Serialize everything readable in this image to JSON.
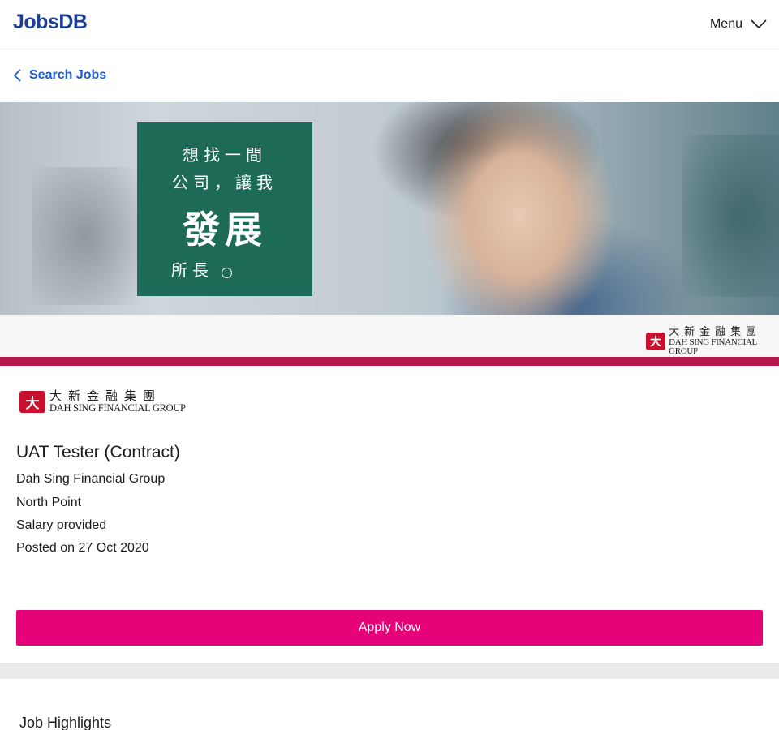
{
  "header": {
    "logo_text": "JobsDB",
    "menu_label": "Menu"
  },
  "breadcrumb": {
    "back_label": "Search Jobs"
  },
  "banner": {
    "headline_line1": "想找一間",
    "headline_line2": "公司，讓我",
    "headline_line3": "發展",
    "headline_line4": "所長",
    "brand_color": "#1d6a56",
    "accent_bar_color": "#b51a4d"
  },
  "company_logo": {
    "mark": "大",
    "chinese": "大新金融集團",
    "english": "DAH SING FINANCIAL GROUP"
  },
  "job": {
    "title": "UAT Tester (Contract)",
    "company": "Dah Sing Financial Group",
    "location": "North Point",
    "salary": "Salary provided",
    "posted": "Posted on 27 Oct 2020"
  },
  "actions": {
    "apply_label": "Apply Now",
    "apply_color": "#e60278"
  },
  "sections": {
    "highlights_heading": "Job Highlights"
  },
  "icons": {
    "menu_icon": "chevron-down-icon",
    "back_icon": "chevron-left-icon"
  }
}
